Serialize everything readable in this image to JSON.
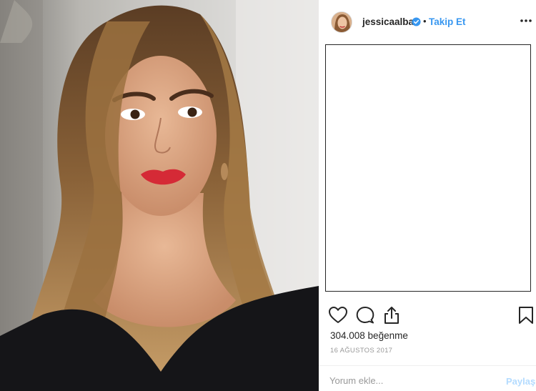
{
  "post": {
    "username": "jessicaalba",
    "separator": "•",
    "follow_label": "Takip Et",
    "likes": "304.008 beğenme",
    "date": "16 AĞUSTOS 2017"
  },
  "icons": {
    "verified": "verified-badge-icon",
    "more": "more-options-icon",
    "like": "heart-icon",
    "comment": "comment-icon",
    "share": "share-icon",
    "save": "bookmark-icon"
  },
  "comment_box": {
    "placeholder": "Yorum ekle...",
    "post_label": "Paylaş"
  },
  "colors": {
    "accent": "#3897f0",
    "post_disabled": "#b3dbff",
    "text": "#262626",
    "muted": "#999999"
  }
}
